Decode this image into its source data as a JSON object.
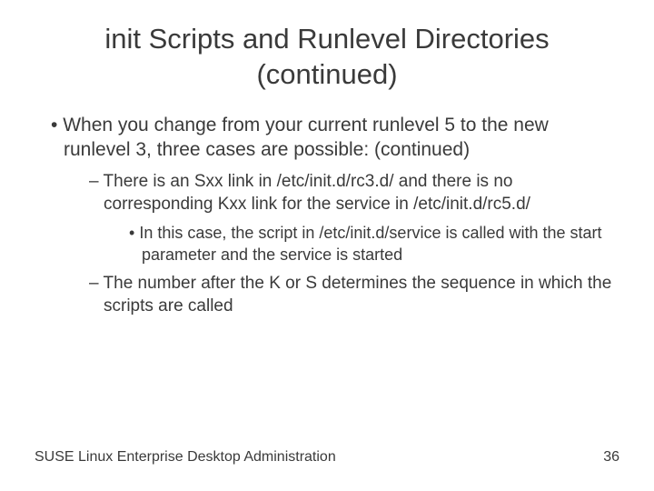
{
  "title": "init Scripts and Runlevel Directories (continued)",
  "bullets": {
    "l1": "When you change from your current runlevel 5 to the new runlevel 3, three cases are possible: (continued)",
    "l2a": "There is an Sxx link in /etc/init.d/rc3.d/ and there is no corresponding Kxx link for the service in /etc/init.d/rc5.d/",
    "l3a": "In this case, the script in /etc/init.d/service is called with the start parameter and the service is started",
    "l2b": "The number after the K or S determines the sequence in which the scripts are called"
  },
  "footer": {
    "left": "SUSE Linux Enterprise Desktop Administration",
    "right": "36"
  }
}
